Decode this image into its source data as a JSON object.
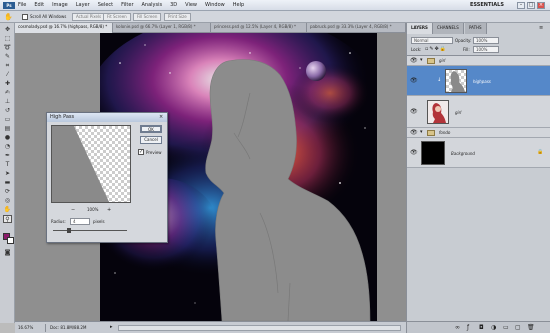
{
  "menubar": {
    "logo": "Ps",
    "items": [
      "File",
      "Edit",
      "Image",
      "Layer",
      "Select",
      "Filter",
      "Analysis",
      "3D",
      "View",
      "Window",
      "Help"
    ],
    "workspace": "ESSENTIALS",
    "min": "–",
    "max": "□",
    "close": "×"
  },
  "options": {
    "scroll_all_label": "Scroll All Windows",
    "buttons": [
      "Actual Pixels",
      "Fit Screen",
      "Fill Screen",
      "Print Size"
    ]
  },
  "tabs": [
    "cosmolady.psd @ 16.7% (highpass, RGB/8) *",
    "kolonie.psd @ 66.7% (Layer 1, RGB/8) *",
    "princess.psd @ 12.5% (Layer 4, RGB/8) *",
    "pabruck.psd @ 33.3% (Layer 4, RGB/8) *"
  ],
  "status": {
    "zoom": "16.67%",
    "doc": "Doc: 81.8M/88.2M"
  },
  "colors": {
    "foreground": "#8b1a6b",
    "background": "#ffffff",
    "selection": "#5588c9"
  },
  "panels": {
    "tabs": [
      "LAYERS",
      "CHANNELS",
      "PATHS"
    ],
    "blend_mode": "Normal",
    "opacity_label": "Opacity:",
    "opacity_value": "100%",
    "lock_label": "Lock:",
    "fill_label": "Fill:",
    "fill_value": "100%",
    "layers": [
      {
        "name": "girl",
        "type": "group"
      },
      {
        "name": "highpass",
        "type": "layer"
      },
      {
        "name": "girl",
        "type": "layer"
      },
      {
        "name": "fondo",
        "type": "group"
      },
      {
        "name": "Background",
        "type": "background"
      }
    ]
  },
  "dialog": {
    "title": "High Pass",
    "ok": "OK",
    "cancel": "Cancel",
    "preview_label": "Preview",
    "zoom": "100%",
    "minus": "−",
    "plus": "+",
    "radius_label": "Radius:",
    "radius_value": "4",
    "radius_unit": "pixels"
  }
}
